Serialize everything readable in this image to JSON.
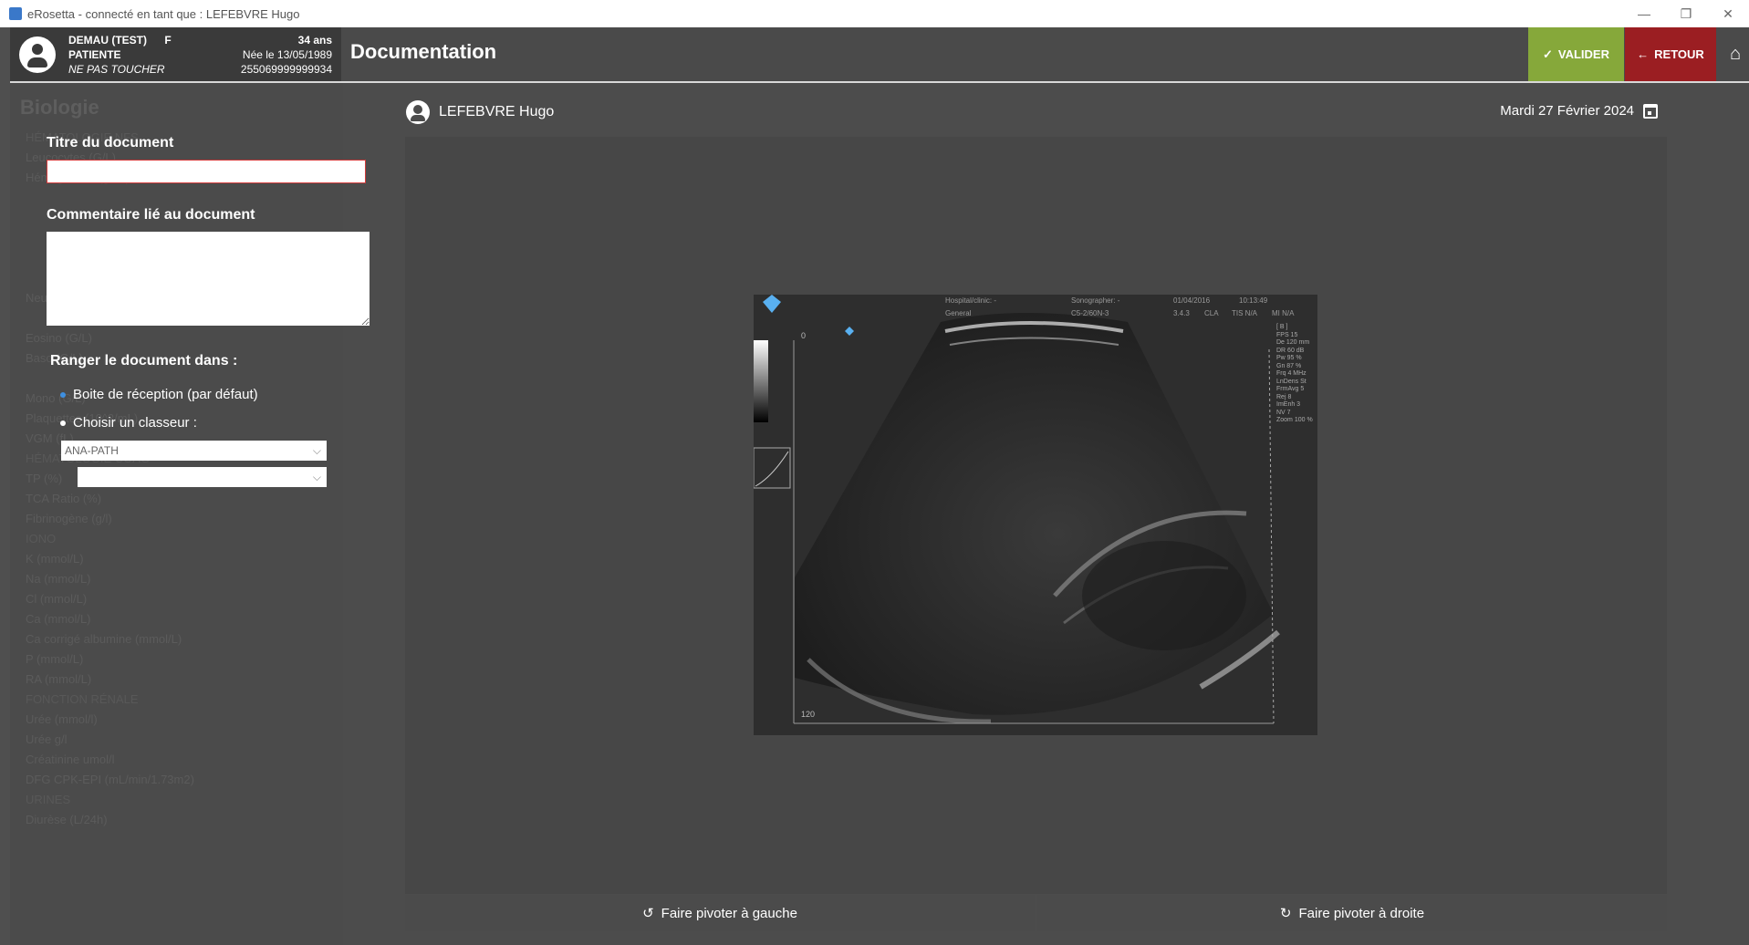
{
  "window": {
    "title": "eRosetta - connecté en tant que : LEFEBVRE Hugo",
    "controls": [
      "—",
      "❐",
      "✕"
    ]
  },
  "patient": {
    "name": "DEMAU (TEST)",
    "sex": "F",
    "type": "PATIENTE",
    "note": "NE PAS TOUCHER",
    "age": "34 ans",
    "birth": "Née le 13/05/1989",
    "id": "255069999999934"
  },
  "header": {
    "title": "Documentation",
    "valider": "VALIDER",
    "retour": "RETOUR"
  },
  "background": {
    "sidebar_title": "Biologie",
    "items": [
      "HÉMATOLOGIE NFS",
      "Leucocytes (G/L)",
      "Hémoglobine (g/dL)",
      "",
      "",
      "",
      "",
      "",
      "Neutro (G/L)",
      "",
      "Eosino (G/L)",
      "Baso (G/L)",
      "",
      "Mono (G/L)",
      "Plaquettes (10^3/mL)",
      "VGM (fL)",
      "HÉMATOLOGIE COAG",
      "TP (%)",
      "TCA Ratio (%)",
      "Fibrinogène (g/l)",
      "IONO",
      "K (mmol/L)",
      "Na (mmol/L)",
      "Cl (mmol/L)",
      "Ca (mmol/L)",
      "Ca corrigé albumine (mmol/L)",
      "P (mmol/L)",
      "RA (mmol/L)",
      "FONCTION RÉNALE",
      "Urée (mmol/l)",
      "Urée g/l",
      "Créatinine umol/l",
      "DFG CPK-EPI (mL/min/1.73m2)",
      "URINES",
      "Diurèse (L/24h)"
    ]
  },
  "form": {
    "titre_label": "Titre du document",
    "titre_value": "",
    "comment_label": "Commentaire lié au document",
    "comment_value": "",
    "ranger_label": "Ranger le document dans :",
    "option_inbox": "Boite de réception (par défaut)",
    "option_classeur": "Choisir un classeur :",
    "classeur_select": "ANA-PATH",
    "sub_select": ""
  },
  "viewer": {
    "user": "LEFEBVRE Hugo",
    "date": "Mardi 27 Février 2024",
    "rotate_left": "Faire pivoter à gauche",
    "rotate_right": "Faire pivoter à droite"
  },
  "ultrasound": {
    "info": [
      "Hospital/clinic: -",
      "Sonographer: -",
      "01/04/2016",
      "10:13:49",
      "General",
      "C5-2/60N-3",
      "3.4.3",
      "CLA",
      "TIS N/A",
      "MI N/A"
    ],
    "params": [
      "[ B ]",
      "FPS 15",
      "De 120 mm",
      "DR 60 dB",
      "Pw 95 %",
      "Gn 87 %",
      "Frq 4 MHz",
      "LnDens St",
      "FrmAvg 5",
      "Rej 8",
      "ImEnh 3",
      "NV 7",
      "Zoom 100 %"
    ],
    "scale": {
      "top": "0",
      "bottom": "120"
    }
  }
}
